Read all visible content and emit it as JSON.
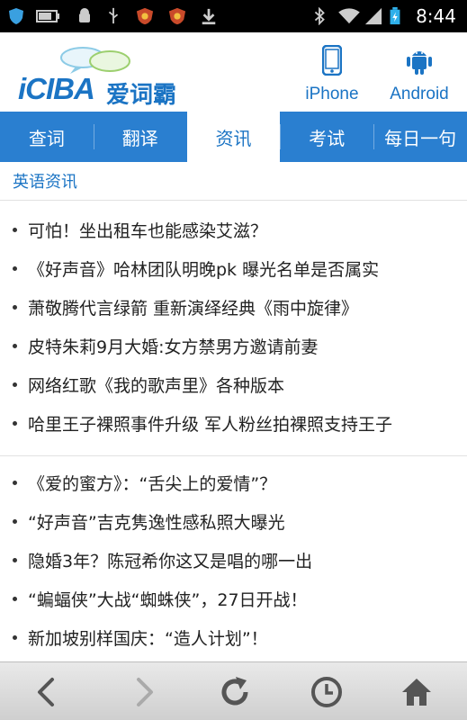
{
  "status_bar": {
    "time": "8:44",
    "icons": [
      "shield-icon",
      "battery-icon",
      "android-debug-icon",
      "usb-icon",
      "app-badge-icon",
      "app-badge-icon",
      "download-icon",
      "bluetooth-icon",
      "wifi-icon",
      "signal-icon",
      "battery-charging-icon"
    ]
  },
  "header": {
    "logo_text": "iCIBA",
    "logo_cn": "爱词霸",
    "platforms": [
      {
        "label": "iPhone",
        "icon": "iphone-icon"
      },
      {
        "label": "Android",
        "icon": "android-icon"
      }
    ]
  },
  "tabs": [
    {
      "label": "查词"
    },
    {
      "label": "翻译"
    },
    {
      "label": "资讯",
      "active": true
    },
    {
      "label": "考试"
    },
    {
      "label": "每日一句"
    }
  ],
  "section": {
    "title": "英语资讯"
  },
  "news_group_1": [
    "可怕！坐出租车也能感染艾滋？",
    "《好声音》哈林团队明晚pk 曝光名单是否属实",
    "萧敬腾代言绿箭 重新演绎经典《雨中旋律》",
    "皮特朱莉9月大婚:女方禁男方邀请前妻",
    "网络红歌《我的歌声里》各种版本",
    "哈里王子裸照事件升级 军人粉丝拍裸照支持王子"
  ],
  "news_group_2": [
    "《爱的蜜方》：“舌尖上的爱情”？",
    "“好声音”吉克隽逸性感私照大曝光",
    "隐婚3年？陈冠希你这又是唱的哪一出",
    "“蝙蝠侠”大战“蜘蛛侠”，27日开战！",
    "新加坡别样国庆：“造人计划”！"
  ],
  "bottom_bar": [
    "back-icon",
    "forward-icon",
    "refresh-icon",
    "history-icon",
    "home-icon"
  ],
  "colors": {
    "brand_blue": "#1b74c4",
    "tab_blue": "#2a7fd0"
  }
}
